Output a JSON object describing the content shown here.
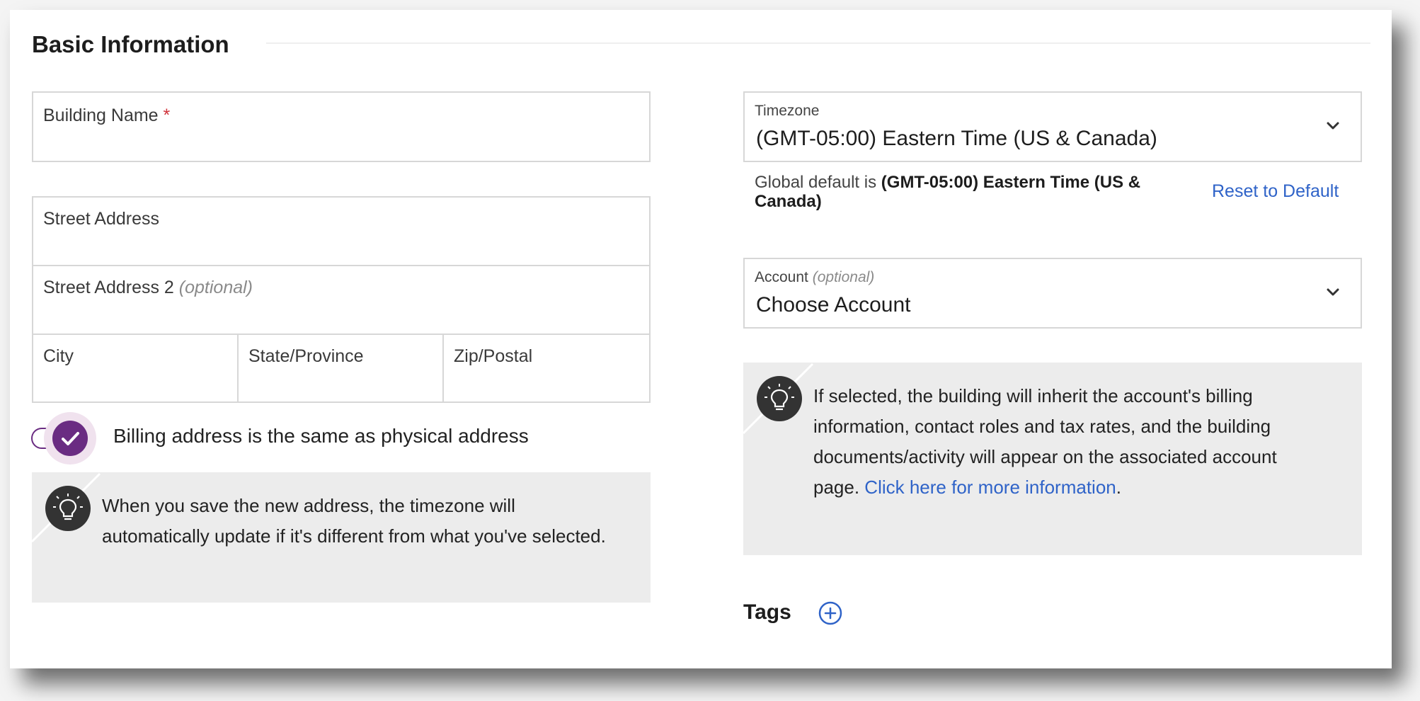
{
  "section": {
    "title": "Basic Information"
  },
  "left": {
    "building_name": {
      "label": "Building Name",
      "required_mark": "*",
      "value": ""
    },
    "street_address": {
      "label": "Street Address",
      "value": ""
    },
    "street_address_2": {
      "label": "Street Address 2",
      "optional": "(optional)",
      "value": ""
    },
    "city": {
      "label": "City",
      "value": ""
    },
    "state": {
      "label": "State/Province",
      "value": ""
    },
    "zip": {
      "label": "Zip/Postal",
      "value": ""
    },
    "billing_toggle": {
      "label": "Billing address is the same as physical address",
      "checked": true
    },
    "tip": {
      "text": "When you save the new address, the timezone will automatically update if it's different from what you've selected."
    }
  },
  "right": {
    "timezone": {
      "label": "Timezone",
      "value": "(GMT-05:00) Eastern Time (US & Canada)"
    },
    "global_default": {
      "prefix": "Global default is ",
      "value": "(GMT-05:00) Eastern Time (US & Canada)"
    },
    "reset_link": "Reset to Default",
    "account": {
      "label": "Account",
      "optional": "(optional)",
      "value": "Choose Account"
    },
    "tip": {
      "text": "If selected, the building will inherit the account's billing information, contact roles and tax rates, and the building documents/activity will appear on the associated account page. ",
      "link": "Click here for more information",
      "suffix": "."
    },
    "tags": {
      "label": "Tags"
    }
  },
  "colors": {
    "accent_purple": "#6a2c82",
    "link_blue": "#2f63c8",
    "tip_bg": "#ececec",
    "required_red": "#d0323a"
  }
}
